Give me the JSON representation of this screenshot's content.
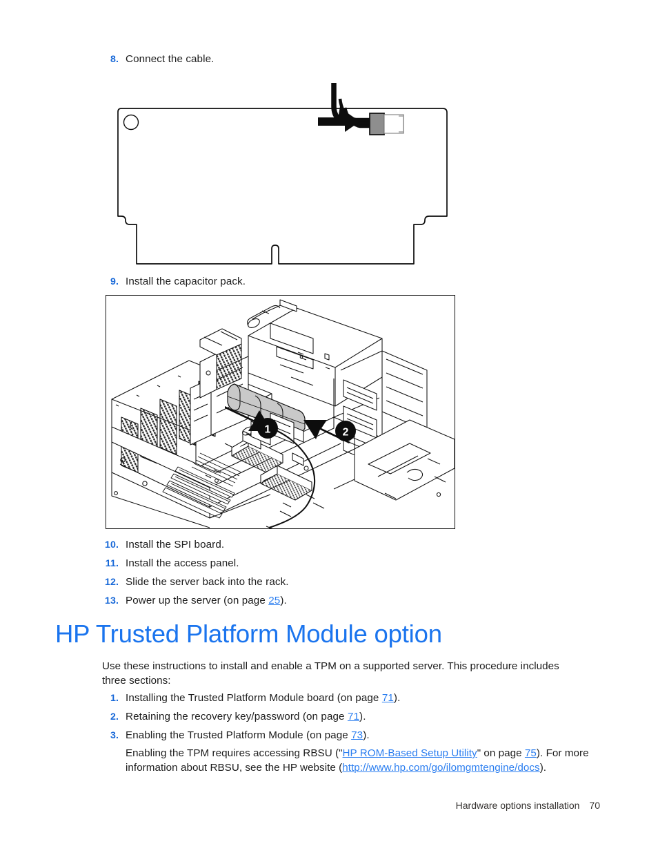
{
  "document": {
    "footer_section": "Hardware options installation",
    "page_number": "70"
  },
  "steps_top": [
    {
      "num": "8.",
      "text": "Connect the cable."
    },
    {
      "num": "9.",
      "text": "Install the capacitor pack."
    }
  ],
  "steps_bottom": [
    {
      "num": "10.",
      "text": "Install the SPI board."
    },
    {
      "num": "11.",
      "text": "Install the access panel."
    },
    {
      "num": "12.",
      "text": "Slide the server back into the rack."
    },
    {
      "num": "13.",
      "text_before": "Power up the server (on page ",
      "page_ref": "25",
      "text_after": ")."
    }
  ],
  "heading": "HP Trusted Platform Module option",
  "intro_paragraph": "Use these instructions to install and enable a TPM on a supported server. This procedure includes three sections:",
  "tpm_steps": [
    {
      "num": "1.",
      "text_before": "Installing the Trusted Platform Module board (on page ",
      "page_ref": "71",
      "text_after": ")."
    },
    {
      "num": "2.",
      "text_before": "Retaining the recovery key/password (on page ",
      "page_ref": "71",
      "text_after": ")."
    },
    {
      "num": "3.",
      "text_before": "Enabling the Trusted Platform Module (on page ",
      "page_ref": "73",
      "text_after": ")."
    }
  ],
  "note_paragraph": {
    "line1_a": "Enabling the TPM requires accessing RBSU (\"",
    "link1": "HP ROM-Based Setup Utility",
    "line1_b": "\" on page ",
    "page_ref": "75",
    "line1_c": "). For more",
    "line2_a": "information about RBSU, see the HP website (",
    "link2": "http://www.hp.com/go/ilomgmtengine/docs",
    "line2_b": ")."
  },
  "figures": {
    "board": {
      "caption_id": "option-board-cable-connection",
      "callouts": []
    },
    "chassis": {
      "caption_id": "capacitor-pack-installation",
      "callouts": [
        "1",
        "2"
      ]
    }
  },
  "colors": {
    "link_blue": "#2b7ef0",
    "heading_blue": "#1a74ee",
    "list_number_blue": "#1768d8",
    "body_text": "#1c1c1c",
    "line_art": "#0d0d0d",
    "connector_gray": "#8e8e8e"
  }
}
